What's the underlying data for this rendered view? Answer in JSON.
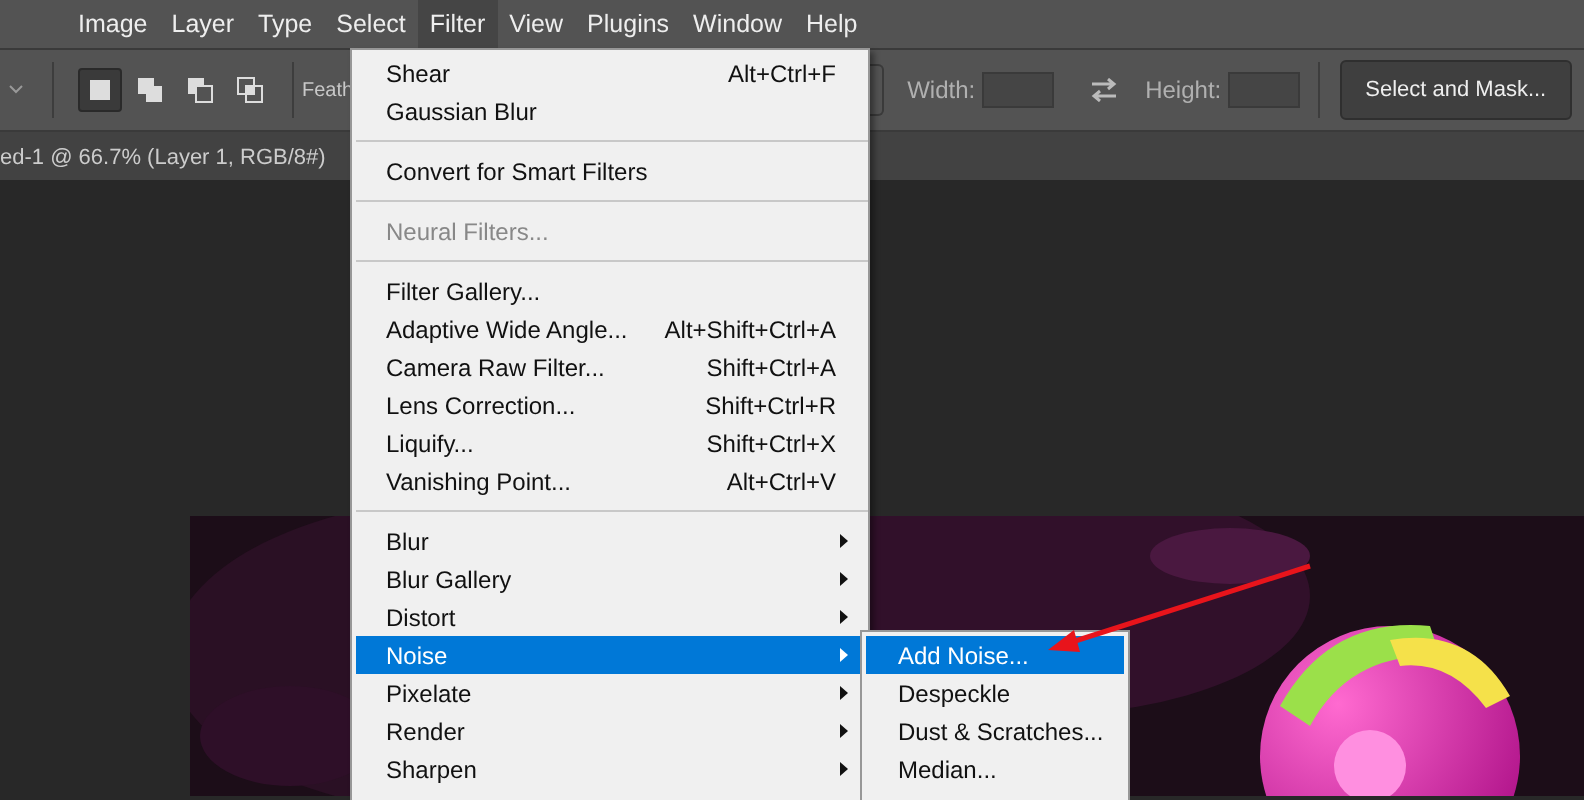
{
  "menu_bar": [
    {
      "label": "Image",
      "selected": false
    },
    {
      "label": "Layer",
      "selected": false
    },
    {
      "label": "Type",
      "selected": false
    },
    {
      "label": "Select",
      "selected": false
    },
    {
      "label": "Filter",
      "selected": true
    },
    {
      "label": "View",
      "selected": false
    },
    {
      "label": "Plugins",
      "selected": false
    },
    {
      "label": "Window",
      "selected": false
    },
    {
      "label": "Help",
      "selected": false
    }
  ],
  "options_bar": {
    "modes": [
      {
        "selected": true
      },
      {
        "selected": false
      },
      {
        "selected": false
      },
      {
        "selected": false
      }
    ],
    "feather_label": "Feath",
    "width_label": "Width:",
    "height_label": "Height:",
    "button": "Select and Mask..."
  },
  "document_tab": {
    "title": "ed-1 @ 66.7% (Layer 1, RGB/8#)"
  },
  "filter_menu": [
    {
      "kind": "item",
      "label": "Shear",
      "shortcut": "Alt+Ctrl+F"
    },
    {
      "kind": "item",
      "label": "Gaussian Blur"
    },
    {
      "kind": "separator"
    },
    {
      "kind": "item",
      "label": "Convert for Smart Filters"
    },
    {
      "kind": "separator"
    },
    {
      "kind": "item",
      "label": "Neural Filters...",
      "disabled": true
    },
    {
      "kind": "separator"
    },
    {
      "kind": "item",
      "label": "Filter Gallery..."
    },
    {
      "kind": "item",
      "label": "Adaptive Wide Angle...",
      "shortcut": "Alt+Shift+Ctrl+A"
    },
    {
      "kind": "item",
      "label": "Camera Raw Filter...",
      "shortcut": "Shift+Ctrl+A"
    },
    {
      "kind": "item",
      "label": "Lens Correction...",
      "shortcut": "Shift+Ctrl+R"
    },
    {
      "kind": "item",
      "label": "Liquify...",
      "shortcut": "Shift+Ctrl+X"
    },
    {
      "kind": "item",
      "label": "Vanishing Point...",
      "shortcut": "Alt+Ctrl+V"
    },
    {
      "kind": "separator"
    },
    {
      "kind": "submenu",
      "label": "Blur",
      "selected": false
    },
    {
      "kind": "submenu",
      "label": "Blur Gallery",
      "selected": false
    },
    {
      "kind": "submenu",
      "label": "Distort",
      "selected": false
    },
    {
      "kind": "submenu",
      "label": "Noise",
      "selected": true
    },
    {
      "kind": "submenu",
      "label": "Pixelate",
      "selected": false
    },
    {
      "kind": "submenu",
      "label": "Render",
      "selected": false
    },
    {
      "kind": "submenu",
      "label": "Sharpen",
      "selected": false
    }
  ],
  "noise_submenu": [
    {
      "label": "Add Noise...",
      "selected": true
    },
    {
      "label": "Despeckle",
      "selected": false
    },
    {
      "label": "Dust & Scratches...",
      "selected": false
    },
    {
      "label": "Median...",
      "selected": false
    }
  ]
}
